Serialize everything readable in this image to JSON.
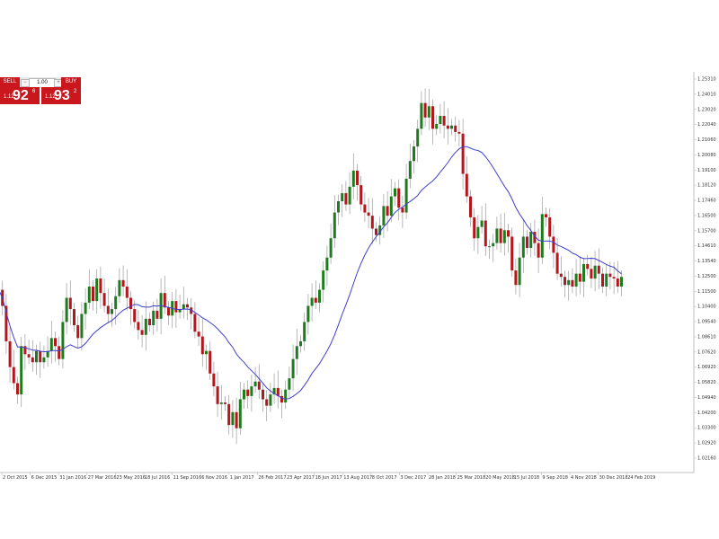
{
  "trade_widget": {
    "sell_label": "SELL",
    "buy_label": "BUY",
    "lot_value": "1.00",
    "minus_symbol": "−",
    "plus_symbol": "+",
    "sell_price_small": "1.12",
    "sell_price_big": "92",
    "sell_price_sup": "6",
    "buy_price_small": "1.12",
    "buy_price_big": "93",
    "buy_price_sup": "2"
  },
  "colors": {
    "bull": "#1e7b1e",
    "bear": "#b3171d",
    "wick": "#9a9a9a",
    "ma": "#3f3fd0",
    "axis": "#bfbfbf",
    "widget_red": "#c9171d"
  },
  "chart_data": {
    "type": "candlestick",
    "y_axis_side": "right",
    "ylim": [
      1.0165,
      1.262
    ],
    "y_ticks": [
      "1.25310",
      "1.24010",
      "1.23020",
      "1.22040",
      "1.21060",
      "1.20080",
      "1.19100",
      "1.18120",
      "1.17460",
      "1.16500",
      "1.15700",
      "1.14610",
      "1.13540",
      "1.12500",
      "1.11500",
      "1.10400",
      "1.09540",
      "1.08610",
      "1.07620",
      "1.06920",
      "1.05820",
      "1.04940",
      "1.04200",
      "1.03300",
      "1.02920",
      "1.02160"
    ],
    "x_ticks": [
      "2 Oct 2015",
      "6 Dec 2015",
      "31 Jan 2016",
      "27 Mar 2016",
      "23 May 2016",
      "18 Jul 2016",
      "11 Sep 2016",
      "6 Nov 2016",
      "1 Jan 2017",
      "26 Feb 2017",
      "23 Apr 2017",
      "18 Jun 2017",
      "13 Aug 2017",
      "8 Oct 2017",
      "3 Dec 2017",
      "28 Jan 2018",
      "25 Mar 2018",
      "20 May 2018",
      "15 Jul 2018",
      "9 Sep 2018",
      "4 Nov 2018",
      "30 Dec 2018",
      "24 Feb 2019"
    ],
    "x_start_label": "2 Oct 2015",
    "candles_per_label": 8,
    "closes": [
      1.13,
      1.12,
      1.098,
      1.082,
      1.072,
      1.065,
      1.095,
      1.09,
      1.088,
      1.085,
      1.092,
      1.085,
      1.088,
      1.092,
      1.1,
      1.095,
      1.087,
      1.11,
      1.125,
      1.118,
      1.108,
      1.1,
      1.115,
      1.122,
      1.132,
      1.123,
      1.137,
      1.128,
      1.12,
      1.115,
      1.118,
      1.126,
      1.136,
      1.132,
      1.125,
      1.118,
      1.11,
      1.105,
      1.102,
      1.112,
      1.108,
      1.117,
      1.112,
      1.128,
      1.119,
      1.114,
      1.123,
      1.116,
      1.118,
      1.121,
      1.119,
      1.115,
      1.104,
      1.101,
      1.09,
      1.092,
      1.078,
      1.07,
      1.059,
      1.06,
      1.059,
      1.046,
      1.054,
      1.044,
      1.062,
      1.068,
      1.064,
      1.07,
      1.073,
      1.068,
      1.062,
      1.058,
      1.065,
      1.069,
      1.064,
      1.06,
      1.068,
      1.075,
      1.087,
      1.095,
      1.098,
      1.11,
      1.12,
      1.125,
      1.122,
      1.13,
      1.142,
      1.15,
      1.162,
      1.178,
      1.185,
      1.19,
      1.183,
      1.194,
      1.204,
      1.195,
      1.183,
      1.178,
      1.176,
      1.168,
      1.164,
      1.17,
      1.182,
      1.176,
      1.188,
      1.193,
      1.181,
      1.178,
      1.199,
      1.21,
      1.219,
      1.23,
      1.246,
      1.237,
      1.244,
      1.23,
      1.233,
      1.238,
      1.232,
      1.23,
      1.232,
      1.228,
      1.227,
      1.202,
      1.188,
      1.175,
      1.162,
      1.169,
      1.173,
      1.157,
      1.157,
      1.159,
      1.168,
      1.159,
      1.167,
      1.163,
      1.142,
      1.133,
      1.15,
      1.163,
      1.156,
      1.166,
      1.159,
      1.15,
      1.177,
      1.175,
      1.163,
      1.153,
      1.14,
      1.138,
      1.133,
      1.136,
      1.132,
      1.14,
      1.135,
      1.146,
      1.143,
      1.137,
      1.145,
      1.14,
      1.132,
      1.14,
      1.138,
      1.137,
      1.132,
      1.138
    ],
    "moving_average": {
      "name": "",
      "period": 20
    }
  }
}
